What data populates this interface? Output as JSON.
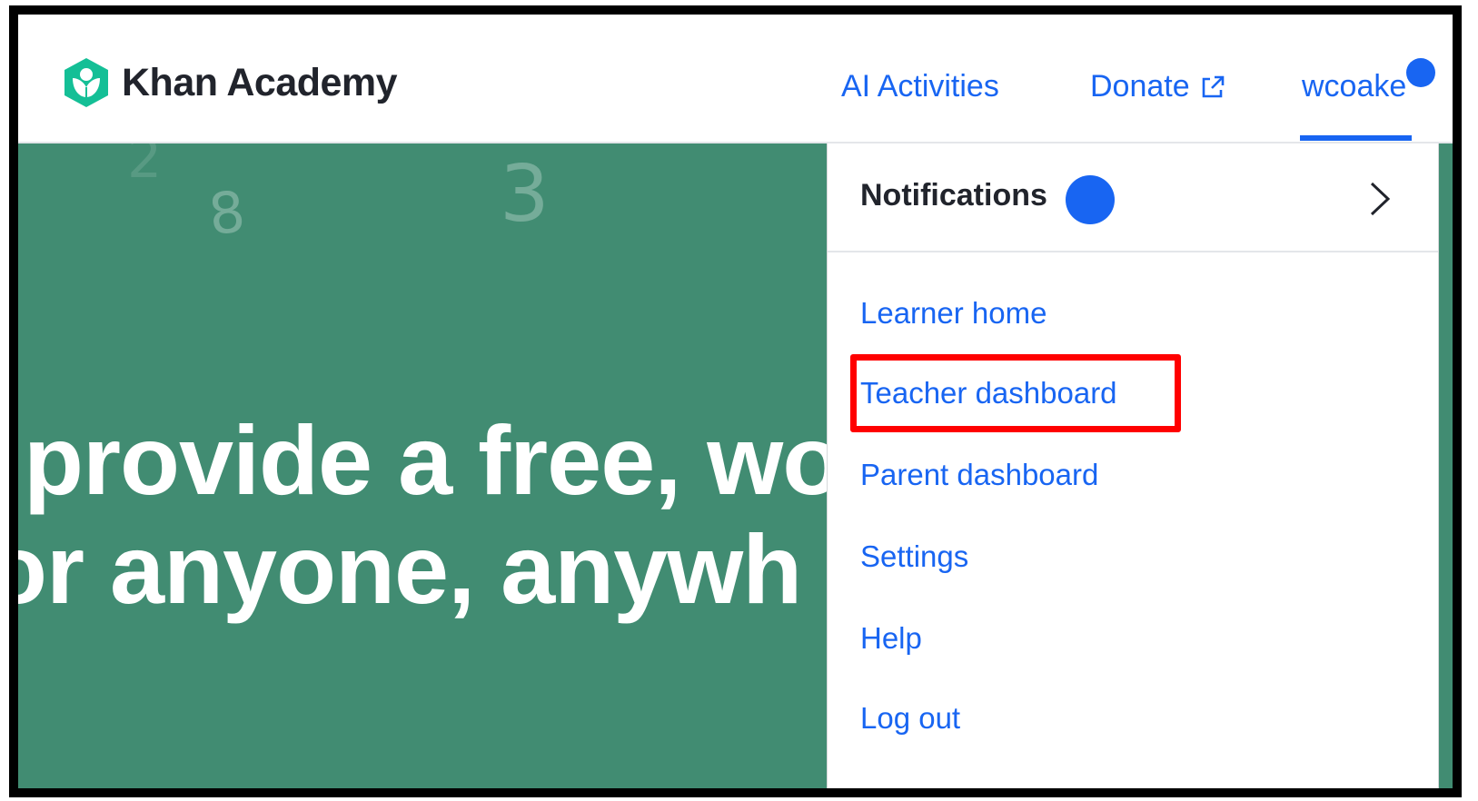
{
  "header": {
    "brand": "Khan Academy",
    "logo_icon": "khan-academy-hexagon-leaf-icon",
    "nav": {
      "ai_activities": "AI Activities",
      "donate": "Donate",
      "donate_icon": "external-link-icon",
      "username": "wcoake"
    }
  },
  "hero": {
    "chalk_digits": [
      "3",
      "8",
      "2"
    ],
    "line1": "provide a free, wo",
    "line2": "or anyone, anywh"
  },
  "menu": {
    "notifications_label": "Notifications",
    "notifications_icon": "chevron-right-icon",
    "items": [
      {
        "label": "Learner home"
      },
      {
        "label": "Teacher dashboard",
        "highlighted": true
      },
      {
        "label": "Parent dashboard"
      },
      {
        "label": "Settings"
      },
      {
        "label": "Help"
      },
      {
        "label": "Log out"
      }
    ]
  },
  "colors": {
    "brand_green": "#418c72",
    "logo_green": "#14bf96",
    "link_blue": "#1865f2",
    "text_dark": "#21242c",
    "highlight_red": "#ff0000"
  }
}
